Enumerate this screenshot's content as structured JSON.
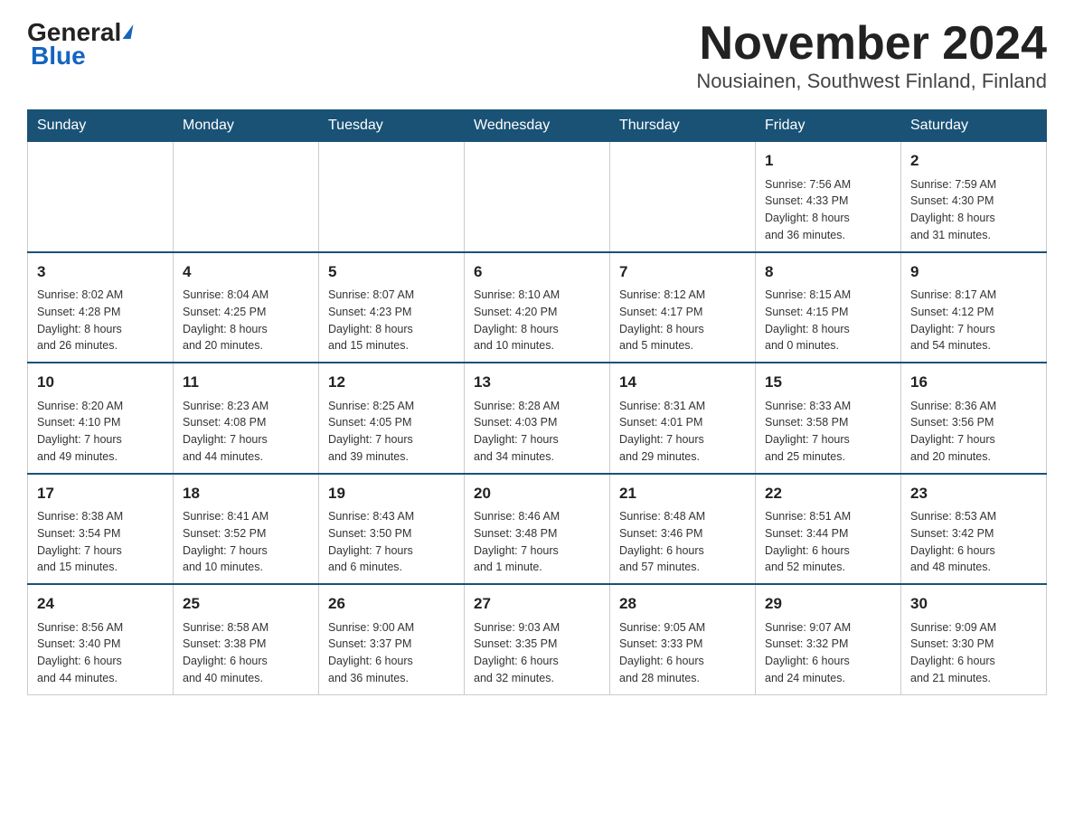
{
  "header": {
    "logo_general": "General",
    "logo_blue": "Blue",
    "title": "November 2024",
    "subtitle": "Nousiainen, Southwest Finland, Finland"
  },
  "days_of_week": [
    "Sunday",
    "Monday",
    "Tuesday",
    "Wednesday",
    "Thursday",
    "Friday",
    "Saturday"
  ],
  "weeks": [
    [
      {
        "day": "",
        "info": ""
      },
      {
        "day": "",
        "info": ""
      },
      {
        "day": "",
        "info": ""
      },
      {
        "day": "",
        "info": ""
      },
      {
        "day": "",
        "info": ""
      },
      {
        "day": "1",
        "info": "Sunrise: 7:56 AM\nSunset: 4:33 PM\nDaylight: 8 hours\nand 36 minutes."
      },
      {
        "day": "2",
        "info": "Sunrise: 7:59 AM\nSunset: 4:30 PM\nDaylight: 8 hours\nand 31 minutes."
      }
    ],
    [
      {
        "day": "3",
        "info": "Sunrise: 8:02 AM\nSunset: 4:28 PM\nDaylight: 8 hours\nand 26 minutes."
      },
      {
        "day": "4",
        "info": "Sunrise: 8:04 AM\nSunset: 4:25 PM\nDaylight: 8 hours\nand 20 minutes."
      },
      {
        "day": "5",
        "info": "Sunrise: 8:07 AM\nSunset: 4:23 PM\nDaylight: 8 hours\nand 15 minutes."
      },
      {
        "day": "6",
        "info": "Sunrise: 8:10 AM\nSunset: 4:20 PM\nDaylight: 8 hours\nand 10 minutes."
      },
      {
        "day": "7",
        "info": "Sunrise: 8:12 AM\nSunset: 4:17 PM\nDaylight: 8 hours\nand 5 minutes."
      },
      {
        "day": "8",
        "info": "Sunrise: 8:15 AM\nSunset: 4:15 PM\nDaylight: 8 hours\nand 0 minutes."
      },
      {
        "day": "9",
        "info": "Sunrise: 8:17 AM\nSunset: 4:12 PM\nDaylight: 7 hours\nand 54 minutes."
      }
    ],
    [
      {
        "day": "10",
        "info": "Sunrise: 8:20 AM\nSunset: 4:10 PM\nDaylight: 7 hours\nand 49 minutes."
      },
      {
        "day": "11",
        "info": "Sunrise: 8:23 AM\nSunset: 4:08 PM\nDaylight: 7 hours\nand 44 minutes."
      },
      {
        "day": "12",
        "info": "Sunrise: 8:25 AM\nSunset: 4:05 PM\nDaylight: 7 hours\nand 39 minutes."
      },
      {
        "day": "13",
        "info": "Sunrise: 8:28 AM\nSunset: 4:03 PM\nDaylight: 7 hours\nand 34 minutes."
      },
      {
        "day": "14",
        "info": "Sunrise: 8:31 AM\nSunset: 4:01 PM\nDaylight: 7 hours\nand 29 minutes."
      },
      {
        "day": "15",
        "info": "Sunrise: 8:33 AM\nSunset: 3:58 PM\nDaylight: 7 hours\nand 25 minutes."
      },
      {
        "day": "16",
        "info": "Sunrise: 8:36 AM\nSunset: 3:56 PM\nDaylight: 7 hours\nand 20 minutes."
      }
    ],
    [
      {
        "day": "17",
        "info": "Sunrise: 8:38 AM\nSunset: 3:54 PM\nDaylight: 7 hours\nand 15 minutes."
      },
      {
        "day": "18",
        "info": "Sunrise: 8:41 AM\nSunset: 3:52 PM\nDaylight: 7 hours\nand 10 minutes."
      },
      {
        "day": "19",
        "info": "Sunrise: 8:43 AM\nSunset: 3:50 PM\nDaylight: 7 hours\nand 6 minutes."
      },
      {
        "day": "20",
        "info": "Sunrise: 8:46 AM\nSunset: 3:48 PM\nDaylight: 7 hours\nand 1 minute."
      },
      {
        "day": "21",
        "info": "Sunrise: 8:48 AM\nSunset: 3:46 PM\nDaylight: 6 hours\nand 57 minutes."
      },
      {
        "day": "22",
        "info": "Sunrise: 8:51 AM\nSunset: 3:44 PM\nDaylight: 6 hours\nand 52 minutes."
      },
      {
        "day": "23",
        "info": "Sunrise: 8:53 AM\nSunset: 3:42 PM\nDaylight: 6 hours\nand 48 minutes."
      }
    ],
    [
      {
        "day": "24",
        "info": "Sunrise: 8:56 AM\nSunset: 3:40 PM\nDaylight: 6 hours\nand 44 minutes."
      },
      {
        "day": "25",
        "info": "Sunrise: 8:58 AM\nSunset: 3:38 PM\nDaylight: 6 hours\nand 40 minutes."
      },
      {
        "day": "26",
        "info": "Sunrise: 9:00 AM\nSunset: 3:37 PM\nDaylight: 6 hours\nand 36 minutes."
      },
      {
        "day": "27",
        "info": "Sunrise: 9:03 AM\nSunset: 3:35 PM\nDaylight: 6 hours\nand 32 minutes."
      },
      {
        "day": "28",
        "info": "Sunrise: 9:05 AM\nSunset: 3:33 PM\nDaylight: 6 hours\nand 28 minutes."
      },
      {
        "day": "29",
        "info": "Sunrise: 9:07 AM\nSunset: 3:32 PM\nDaylight: 6 hours\nand 24 minutes."
      },
      {
        "day": "30",
        "info": "Sunrise: 9:09 AM\nSunset: 3:30 PM\nDaylight: 6 hours\nand 21 minutes."
      }
    ]
  ]
}
